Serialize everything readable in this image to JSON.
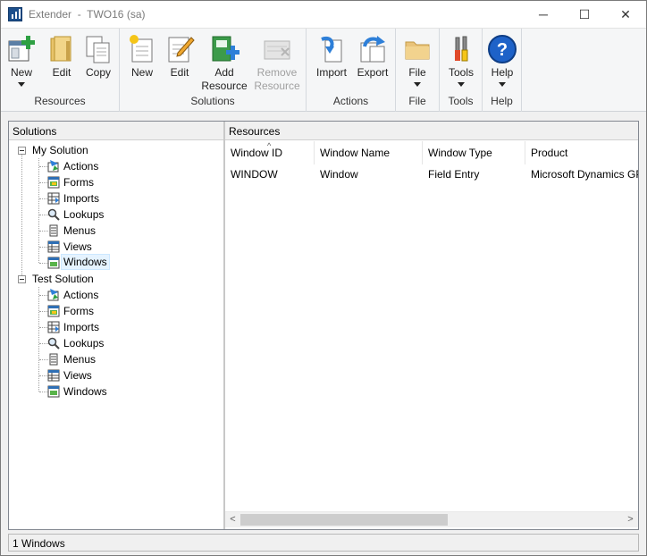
{
  "window": {
    "title": "Extender  -  TWO16 (sa)",
    "controls": {
      "minimize": "─",
      "maximize": "☐",
      "close": "✕"
    }
  },
  "ribbon": {
    "groups": [
      {
        "label": "Resources",
        "buttons": [
          {
            "label": "New",
            "icon": "new-resource-icon",
            "dropdown": true
          },
          {
            "label": "Edit",
            "icon": "folder-edit-icon"
          },
          {
            "label": "Copy",
            "icon": "copy-icon"
          }
        ]
      },
      {
        "label": "Solutions",
        "buttons": [
          {
            "label": "New",
            "icon": "new-solution-icon"
          },
          {
            "label": "Edit",
            "icon": "edit-solution-icon"
          },
          {
            "label": "Add Resource",
            "line1": "Add",
            "line2": "Resource",
            "icon": "add-resource-icon"
          },
          {
            "label": "Remove Resource",
            "line1": "Remove",
            "line2": "Resource",
            "icon": "remove-resource-icon",
            "disabled": true
          }
        ]
      },
      {
        "label": "Actions",
        "buttons": [
          {
            "label": "Import",
            "icon": "import-icon"
          },
          {
            "label": "Export",
            "icon": "export-icon"
          }
        ]
      },
      {
        "label": "File",
        "buttons": [
          {
            "label": "File",
            "icon": "folder-icon",
            "dropdown": true
          }
        ]
      },
      {
        "label": "Tools",
        "buttons": [
          {
            "label": "Tools",
            "icon": "tools-icon",
            "dropdown": true
          }
        ]
      },
      {
        "label": "Help",
        "buttons": [
          {
            "label": "Help",
            "icon": "help-icon",
            "dropdown": true
          }
        ]
      }
    ]
  },
  "solutions_panel": {
    "header": "Solutions",
    "tree": [
      {
        "label": "My Solution",
        "children": [
          "Actions",
          "Forms",
          "Imports",
          "Lookups",
          "Menus",
          "Views",
          "Windows"
        ],
        "selected_child": "Windows"
      },
      {
        "label": "Test Solution",
        "children": [
          "Actions",
          "Forms",
          "Imports",
          "Lookups",
          "Menus",
          "Views",
          "Windows"
        ]
      }
    ]
  },
  "resources_panel": {
    "header": "Resources",
    "columns": [
      "Window ID",
      "Window Name",
      "Window Type",
      "Product"
    ],
    "sort_indicator": "^",
    "rows": [
      [
        "WINDOW",
        "Window",
        "Field Entry",
        "Microsoft Dynamics GP"
      ]
    ]
  },
  "scrollbar": {
    "left_arrow": "<",
    "right_arrow": ">"
  },
  "status": {
    "text": "1 Windows"
  },
  "colors": {
    "accent": "#1c4f8c",
    "selection": "#e5f3ff",
    "help_blue": "#1e62c8",
    "add_green": "#2ea043"
  }
}
